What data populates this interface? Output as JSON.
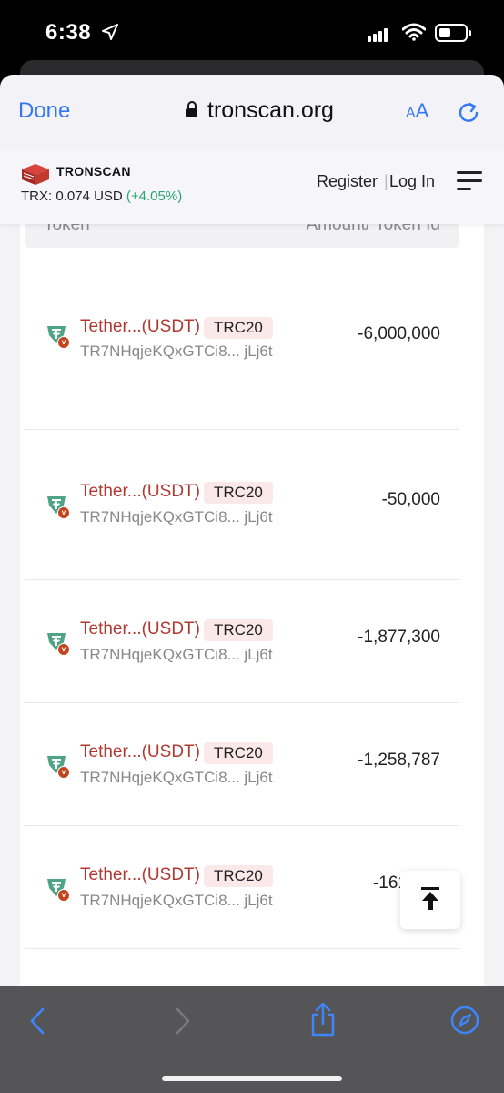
{
  "status": {
    "time": "6:38"
  },
  "browser": {
    "done_label": "Done",
    "url": "tronscan.org",
    "text_size_label": "A",
    "text_size_label_small": "A"
  },
  "site": {
    "logo_text": "TRONSCAN",
    "price_label": "TRX:",
    "price_value": "0.074",
    "price_currency": "USD",
    "price_change": "(+4.05%)",
    "register_label": "Register",
    "separator": "|",
    "login_label": "Log In"
  },
  "table": {
    "col_token": "Token",
    "col_amount": "Amount/ Token Id",
    "rows": [
      {
        "token": "Tether...(USDT)",
        "standard": "TRC20",
        "address": "TR7NHqjeKQxGTCi8... jLj6t",
        "amount": "-6,000,000"
      },
      {
        "token": "Tether...(USDT)",
        "standard": "TRC20",
        "address": "TR7NHqjeKQxGTCi8... jLj6t",
        "amount": "-50,000"
      },
      {
        "token": "Tether...(USDT)",
        "standard": "TRC20",
        "address": "TR7NHqjeKQxGTCi8... jLj6t",
        "amount": "-1,877,300"
      },
      {
        "token": "Tether...(USDT)",
        "standard": "TRC20",
        "address": "TR7NHqjeKQxGTCi8... jLj6t",
        "amount": "-1,258,787"
      },
      {
        "token": "Tether...(USDT)",
        "standard": "TRC20",
        "address": "TR7NHqjeKQxGTCi8... jLj6t",
        "amount": "-161"
      }
    ]
  },
  "colors": {
    "accent_blue": "#3478f6",
    "token_red": "#b03a32",
    "change_green": "#2aa56f",
    "tether_green": "#4fa486"
  }
}
